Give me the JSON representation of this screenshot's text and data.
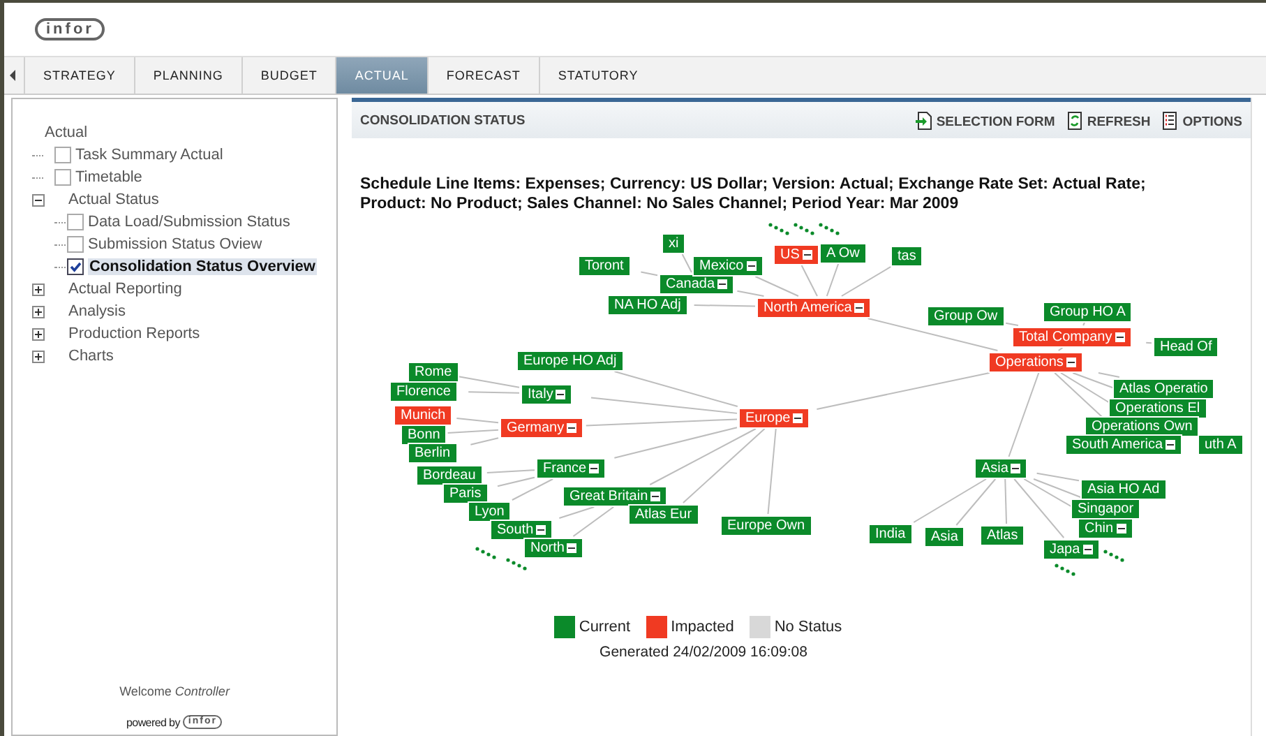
{
  "header": {
    "logo": "infor"
  },
  "tabs": [
    {
      "label": "STRATEGY",
      "selected": false
    },
    {
      "label": "PLANNING",
      "selected": false
    },
    {
      "label": "BUDGET",
      "selected": false
    },
    {
      "label": "ACTUAL",
      "selected": true
    },
    {
      "label": "FORECAST",
      "selected": false
    },
    {
      "label": "STATUTORY",
      "selected": false
    }
  ],
  "sidebar": {
    "tree": {
      "label": "Actual",
      "children": [
        {
          "label": "Task Summary Actual",
          "kind": "checkbox",
          "checked": false
        },
        {
          "label": "Timetable",
          "kind": "checkbox",
          "checked": false
        },
        {
          "label": "Actual Status",
          "kind": "folder",
          "expanded": true,
          "children": [
            {
              "label": "Data Load/Submission Status",
              "kind": "checkbox",
              "checked": false,
              "selected": false
            },
            {
              "label": "Submission Status Oview",
              "kind": "checkbox",
              "checked": false,
              "selected": false
            },
            {
              "label": "Consolidation Status Overview",
              "kind": "checkbox",
              "checked": true,
              "selected": true
            }
          ]
        },
        {
          "label": "Actual Reporting",
          "kind": "folder",
          "expanded": false
        },
        {
          "label": "Analysis",
          "kind": "folder",
          "expanded": false
        },
        {
          "label": "Production Reports",
          "kind": "folder",
          "expanded": false
        },
        {
          "label": "Charts",
          "kind": "folder",
          "expanded": false
        }
      ]
    },
    "welcome": "Welcome *Controller*",
    "powered_by": "powered by",
    "powered_logo": "infor"
  },
  "panel": {
    "title": "CONSOLIDATION STATUS",
    "actions": [
      {
        "label": "SELECTION FORM",
        "kind": "form"
      },
      {
        "label": "REFRESH",
        "kind": "refresh"
      },
      {
        "label": "OPTIONS",
        "kind": "options"
      }
    ],
    "description_lines": [
      "Schedule Line Items: Expenses; Currency: US Dollar; Version: Actual; Exchange Rate Set: Actual Rate;",
      "Product: No Product; Sales Channel: No Sales Channel; Period Year: Mar 2009"
    ]
  },
  "graph": {
    "tree": [
      {
        "label": "Total Company",
        "color": "#f03a22",
        "expanded": true,
        "children": [
          {
            "label": "Group Ow",
            "color": "#0b8a2a"
          },
          {
            "label": "Group HO A",
            "color": "#0b8a2a"
          },
          {
            "label": "Head Of",
            "color": "#0b8a2a"
          },
          {
            "label": "Operations",
            "color": "#f03a22",
            "expanded": true,
            "children": [
              {
                "label": "North America",
                "color": "#f03a22",
                "expanded": true,
                "children": [
                  {
                    "label": "NA HO Adj",
                    "color": "#0b8a2a"
                  },
                  {
                    "label": "Canada",
                    "color": "#0b8a2a",
                    "expanded": true,
                    "children": [
                      {
                        "label": "Toront",
                        "color": "#0b8a2a"
                      },
                      {
                        "label": "xi",
                        "color": "#0b8a2a"
                      }
                    ]
                  },
                  {
                    "label": "US",
                    "color": "#f03a22",
                    "expanded": true
                  },
                  {
                    "label": "Mexico",
                    "color": "#0b8a2a",
                    "expanded": true
                  },
                  {
                    "label": "A Ow",
                    "color": "#0b8a2a"
                  },
                  {
                    "label": "tas",
                    "color": "#0b8a2a"
                  }
                ]
              },
              {
                "label": "Europe",
                "color": "#f03a22",
                "expanded": true,
                "children": [
                  {
                    "label": "Europe HO Adj",
                    "color": "#0b8a2a"
                  },
                  {
                    "label": "Italy",
                    "color": "#0b8a2a",
                    "expanded": true,
                    "children": [
                      {
                        "label": "Rome",
                        "color": "#0b8a2a"
                      },
                      {
                        "label": "Florence",
                        "color": "#0b8a2a"
                      }
                    ]
                  },
                  {
                    "label": "Germany",
                    "color": "#f03a22",
                    "expanded": true,
                    "children": [
                      {
                        "label": "Munich",
                        "color": "#f03a22"
                      },
                      {
                        "label": "Bonn",
                        "color": "#0b8a2a"
                      },
                      {
                        "label": "Berlin",
                        "color": "#0b8a2a"
                      }
                    ]
                  },
                  {
                    "label": "France",
                    "color": "#0b8a2a",
                    "expanded": true,
                    "children": [
                      {
                        "label": "Bordeau",
                        "color": "#0b8a2a"
                      },
                      {
                        "label": "Paris",
                        "color": "#0b8a2a"
                      },
                      {
                        "label": "Lyon",
                        "color": "#0b8a2a"
                      }
                    ]
                  },
                  {
                    "label": "Great Britain",
                    "color": "#0b8a2a",
                    "expanded": true,
                    "children": [
                      {
                        "label": "South",
                        "color": "#0b8a2a",
                        "expanded": true
                      },
                      {
                        "label": "North",
                        "color": "#0b8a2a",
                        "expanded": true
                      }
                    ]
                  },
                  {
                    "label": "Atlas Eur",
                    "color": "#0b8a2a"
                  },
                  {
                    "label": "Europe Own",
                    "color": "#0b8a2a"
                  }
                ]
              },
              {
                "label": "Asia",
                "color": "#0b8a2a",
                "expanded": true,
                "children": [
                  {
                    "label": "Asia HO Ad",
                    "color": "#0b8a2a"
                  },
                  {
                    "label": "Singapor",
                    "color": "#0b8a2a"
                  },
                  {
                    "label": "Chin",
                    "color": "#0b8a2a",
                    "expanded": true
                  },
                  {
                    "label": "Japa",
                    "color": "#0b8a2a",
                    "expanded": true
                  },
                  {
                    "label": "India",
                    "color": "#0b8a2a"
                  },
                  {
                    "label": "Asia",
                    "color": "#0b8a2a"
                  },
                  {
                    "label": "Atlas",
                    "color": "#0b8a2a"
                  }
                ]
              },
              {
                "label": "Atlas Operatio",
                "color": "#0b8a2a"
              },
              {
                "label": "Operations El",
                "color": "#0b8a2a"
              },
              {
                "label": "Operations Own",
                "color": "#0b8a2a"
              },
              {
                "label": "South America",
                "color": "#0b8a2a",
                "expanded": true,
                "children": [
                  {
                    "label": "uth A",
                    "color": "#0b8a2a"
                  }
                ]
              }
            ]
          }
        ]
      }
    ],
    "legend": [
      {
        "label": "Current",
        "color": "#0b8a2a"
      },
      {
        "label": "Impacted",
        "color": "#f03a22"
      },
      {
        "label": "No Status",
        "color": "#d8d8d8"
      }
    ],
    "generated": "Generated 24/02/2009 16:09:08"
  }
}
